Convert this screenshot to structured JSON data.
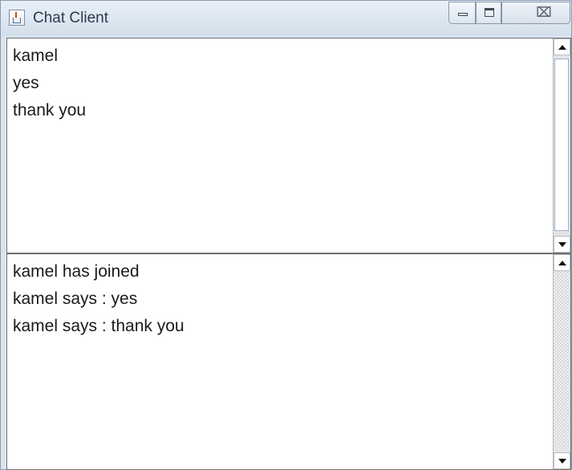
{
  "window": {
    "title": "Chat Client",
    "app_icon": "java-cup-icon",
    "controls": {
      "minimize_icon": "minimize-icon",
      "maximize_icon": "maximize-icon",
      "close_glyph": "⌧"
    }
  },
  "input_area": {
    "lines": [
      "kamel",
      "yes",
      "thank you"
    ]
  },
  "chat_log": {
    "lines": [
      "kamel has joined",
      "kamel says : yes",
      "kamel says : thank you"
    ]
  },
  "colors": {
    "title_bar": "#d3dfeb",
    "text": "#1a1a1a",
    "pane_border": "#707070"
  }
}
